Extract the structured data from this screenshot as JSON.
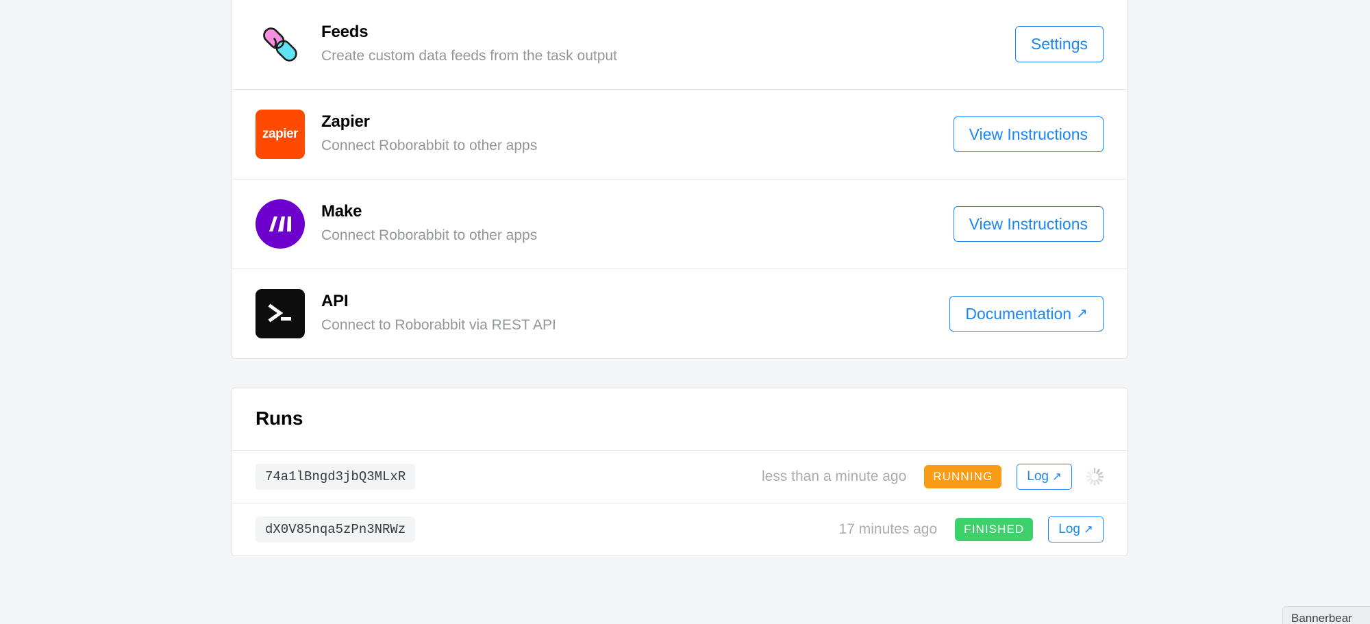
{
  "background_color": "#f4f5f7",
  "accent_color": "#1a86f5",
  "integrations": {
    "rows": [
      {
        "id": "feeds",
        "icon": "chain-link-icon",
        "title": "Feeds",
        "subtitle": "Create custom data feeds from the task output",
        "action_label": "Settings",
        "action_external": false
      },
      {
        "id": "zapier",
        "icon": "zapier-logo-icon",
        "icon_text": "zapier",
        "icon_color": "#ff4a00",
        "title": "Zapier",
        "subtitle": "Connect Roborabbit to other apps",
        "action_label": "View Instructions",
        "action_external": false
      },
      {
        "id": "make",
        "icon": "make-logo-icon",
        "icon_color": "#6d00cc",
        "title": "Make",
        "subtitle": "Connect Roborabbit to other apps",
        "action_label": "View Instructions",
        "action_external": false
      },
      {
        "id": "api",
        "icon": "terminal-prompt-icon",
        "icon_color": "#0d0d0d",
        "title": "API",
        "subtitle": "Connect to Roborabbit via REST API",
        "action_label": "Documentation",
        "action_external": true,
        "action_arrow": "↗"
      }
    ]
  },
  "runs": {
    "title": "Runs",
    "rows": [
      {
        "run_id": "74a1lBngd3jbQ3MLxR",
        "time": "less than a minute ago",
        "status": "RUNNING",
        "status_color": "#fa9b16",
        "log_label": "Log",
        "log_arrow": "↗",
        "loading": true
      },
      {
        "run_id": "dX0V85nqa5zPn3NRWz",
        "time": "17 minutes ago",
        "status": "FINISHED",
        "status_color": "#3ed16b",
        "log_label": "Log",
        "log_arrow": "↗",
        "loading": false
      }
    ]
  },
  "bannerbear": {
    "label": "Bannerbear"
  }
}
